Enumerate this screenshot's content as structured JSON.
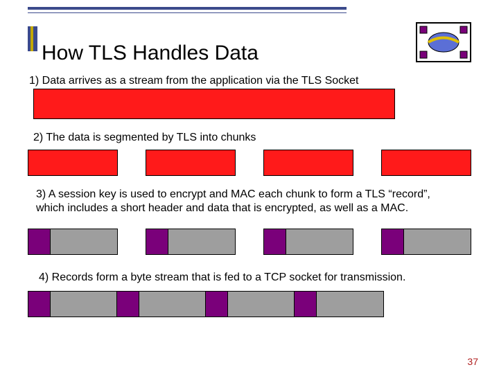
{
  "title": "How TLS Handles Data",
  "steps": {
    "s1": "1) Data arrives as a stream from the application via the TLS Socket",
    "s2": "2) The data is segmented by TLS into chunks",
    "s3": "3) A session key is used to encrypt and MAC each chunk to form a TLS “record”,",
    "s3b": "which includes a short header and data that is encrypted, as well as a MAC.",
    "s4": "4) Records form a byte stream that is fed to a TCP socket for transmission."
  },
  "page_number": "37",
  "icons": {
    "logo": "cloud-network-icon"
  },
  "colors": {
    "red": "#ff1a1a",
    "purple": "#7a007a",
    "grey": "#9e9e9e",
    "accent_blue": "#3b4a8c",
    "accent_gold": "#c2a800"
  }
}
